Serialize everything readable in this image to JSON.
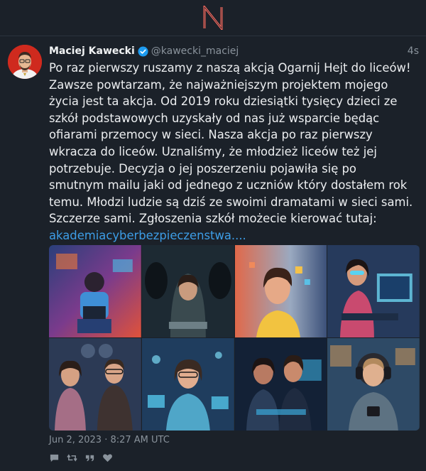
{
  "app": {
    "logo": "N-logo-icon"
  },
  "post": {
    "author_name": "Maciej Kawecki",
    "author_handle": "@kawecki_maciej",
    "relative_time": "4s",
    "text": "Po raz pierwszy ruszamy z naszą akcją Ogarnij Hejt do liceów!\nZawsze powtarzam, że najważniejszym projektem mojego\nżycia jest ta akcja. Od 2019 roku dziesiątki tysięcy dzieci ze\nszkół podstawowych uzyskały od nas już wsparcie będąc\nofiarami przemocy w sieci. Nasza akcja po raz pierwszy\nwkracza do liceów. Uznaliśmy, że młodzież liceów też jej\npotrzebuje. Decyzja o jej poszerzeniu pojawiła się po\nsmutnym mailu jaki od jednego z uczniów który dostałem rok\ntemu. Młodzi ludzie są dziś ze swoimi dramatami w sieci sami.\nSzczerze sami. Zgłoszenia szkół możecie kierować tutaj:",
    "link_text": "akademiacyberbezpieczenstwa....",
    "date": "Jun 2, 2023 · 8:27 AM UTC"
  },
  "icons": {
    "verified": "verified-badge-icon",
    "reply": "reply-icon",
    "retweet": "retweet-icon",
    "quote": "quote-icon",
    "like": "heart-icon"
  },
  "colors": {
    "background": "#1b2129",
    "accent_logo": "#ff6c60",
    "link": "#3d9de6",
    "verified": "#1d9bf0",
    "muted": "#8a939c"
  }
}
